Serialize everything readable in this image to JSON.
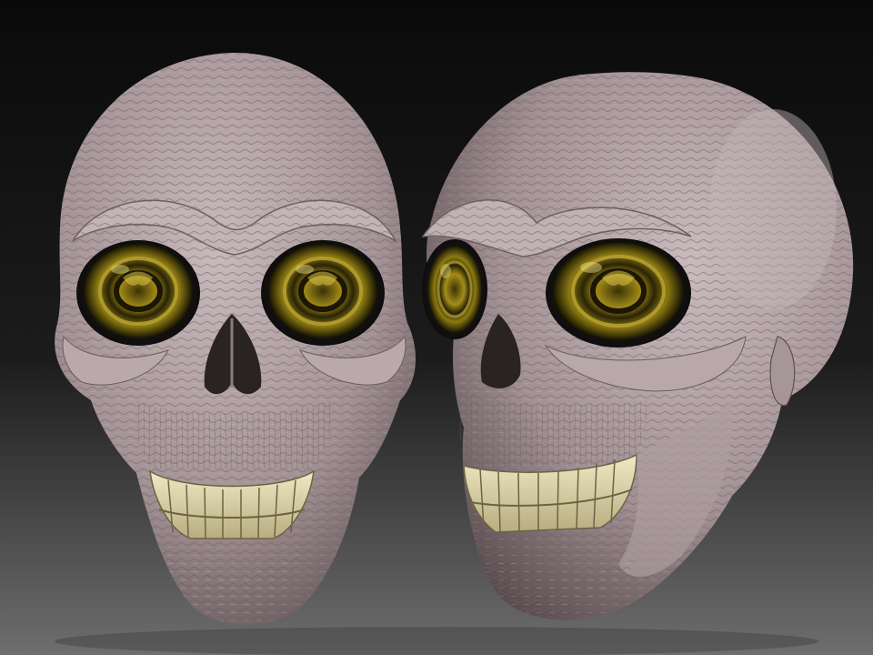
{
  "scene": {
    "background_top": "#0a0a0a",
    "background_bottom": "#6e6e6e",
    "bone_color": "#b3a3a6",
    "bone_shadow": "#5f5154",
    "teeth_color": "#e6dfb4",
    "eye_color": "#8c7a12",
    "eye_dark": "#1d1a05"
  },
  "subjects": [
    {
      "label": "skull-front-view"
    },
    {
      "label": "skull-three-quarter-view"
    }
  ]
}
